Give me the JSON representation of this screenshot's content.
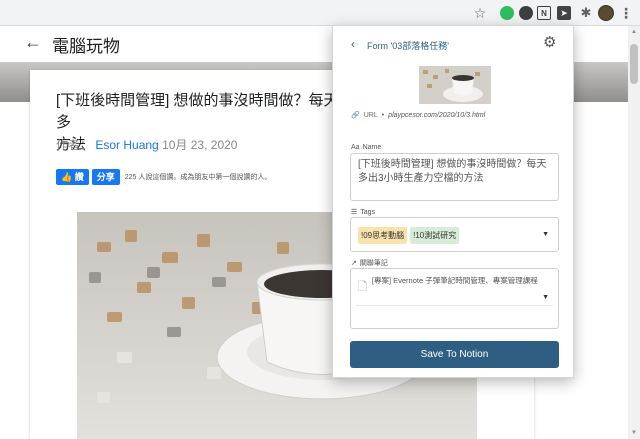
{
  "site": {
    "title": "電腦玩物"
  },
  "article": {
    "title": "[下班後時間管理] 想做的事沒時間做？每天多出3小時生產力空檔的方法",
    "title_visible": "[下班後時間管理] 想做的事沒時間做？每天多",
    "title_line2": "方法",
    "byline_prefix": "作者：",
    "author": "Esor Huang",
    "date": "10月 23, 2020",
    "fb": {
      "like_label": "讚",
      "share_label": "分享",
      "count_text": "225 人說這個讚。成為朋友中第一個說讚的人。"
    }
  },
  "popup": {
    "back_glyph": "‹",
    "header": "Form '03部落格任務'",
    "url_label": "URL",
    "url_value": "playpcesor.com/2020/10/3.html",
    "name_label": "Name",
    "name_value": "[下班後時間管理] 想做的事沒時間做？每天多出3小時生產力空檔的方法",
    "tags_label": "Tags",
    "tags": [
      {
        "label": "!09思考動腦",
        "color": "#f8e3ad"
      },
      {
        "label": "!10測試研究",
        "color": "#d6ecd9"
      }
    ],
    "relation_label": "關聯筆記",
    "relation_value": "[專案] Evernote 子彈筆記時間管理、專案管理課程",
    "save_label": "Save To Notion"
  },
  "icons": {
    "back_arrow": "arrow-left-icon",
    "gear": "gear-icon",
    "link": "link-icon",
    "text": "text-icon",
    "list": "list-icon",
    "relation": "arrow-up-right-icon",
    "doc": "document-icon",
    "caret": "caret-down-icon"
  },
  "colors": {
    "accent": "#2e5e82",
    "link": "#1a73e8",
    "facebook": "#1877f2"
  }
}
